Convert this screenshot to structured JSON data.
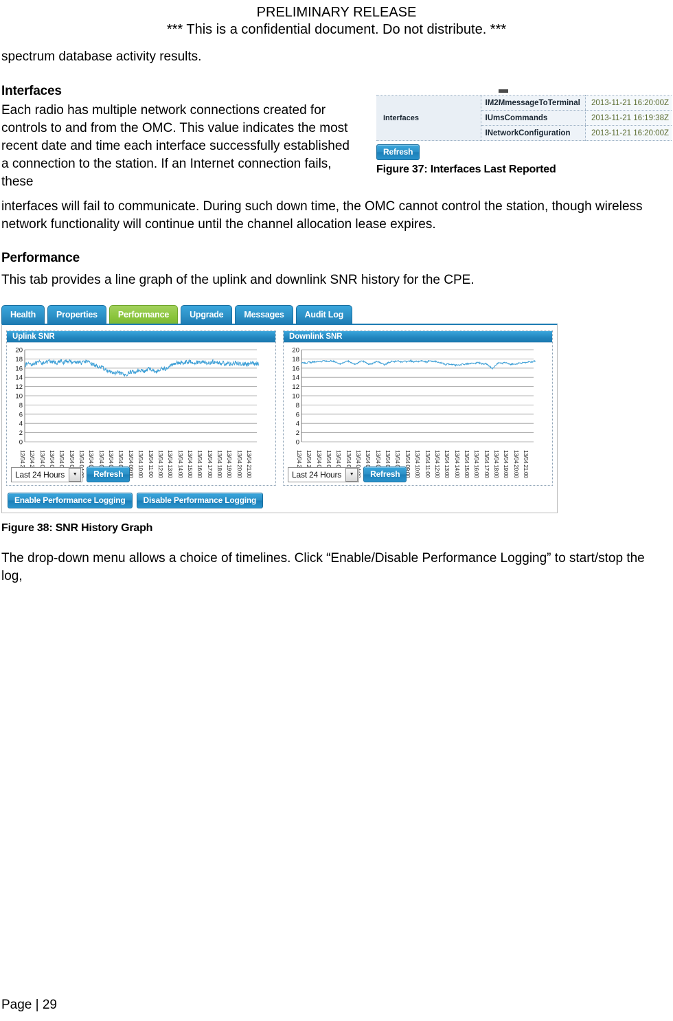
{
  "doc_header": {
    "line1": "PRELIMINARY RELEASE",
    "line2": "*** This is a confidential document. Do not distribute. ***"
  },
  "intro_text": "spectrum database activity results.",
  "sections": {
    "interfaces": {
      "heading": "Interfaces",
      "paragraph_a": "Each radio has multiple network connections created for controls to and from the OMC. This value indicates the most recent date and time each interface successfully established a connection to the station. If an Internet connection fails, these",
      "paragraph_b": "interfaces will fail to communicate. During such down time, the OMC cannot control the station, though wireless network functionality will continue until the channel allocation lease expires."
    },
    "performance": {
      "heading": "Performance",
      "paragraph": "This tab provides a line graph of the uplink and downlink SNR history for the CPE.",
      "closing": "The drop-down menu allows a choice of timelines. Click “Enable/Disable Performance Logging” to start/stop the log,"
    }
  },
  "figure37": {
    "caption": "Figure 37: Interfaces Last Reported",
    "row_label": "Interfaces",
    "rows": [
      {
        "name": "IM2MmessageToTerminal",
        "date": "2013-11-21 16:20:00Z"
      },
      {
        "name": "IUmsCommands",
        "date": "2013-11-21 16:19:38Z"
      },
      {
        "name": "INetworkConfiguration",
        "date": "2013-11-21 16:20:00Z"
      }
    ],
    "refresh_label": "Refresh"
  },
  "figure38": {
    "caption": "Figure 38: SNR History Graph",
    "tabs": [
      {
        "label": "Health",
        "active": false
      },
      {
        "label": "Properties",
        "active": false
      },
      {
        "label": "Performance",
        "active": true
      },
      {
        "label": "Upgrade",
        "active": false
      },
      {
        "label": "Messages",
        "active": false
      },
      {
        "label": "Audit Log",
        "active": false
      }
    ],
    "timeline_selected": "Last 24 Hours",
    "refresh_label": "Refresh",
    "enable_logging_label": "Enable Performance Logging",
    "disable_logging_label": "Disable Performance Logging",
    "colors": {
      "line": "#3d9fd6",
      "tab_active": "#8cc63e",
      "tab_blue": "#2e93c9",
      "panel_header": "#2184bd"
    }
  },
  "chart_data": [
    {
      "type": "line",
      "title": "Uplink SNR",
      "xlabel": "",
      "ylabel": "",
      "ylim": [
        0,
        20
      ],
      "yticks": [
        0,
        2,
        4,
        6,
        8,
        10,
        12,
        14,
        16,
        18,
        20
      ],
      "grid": true,
      "legend": "none",
      "tick_labels": [
        "12/04 22:00",
        "12/04 23:00",
        "13/04 00:00",
        "13/04 01:00",
        "13/04 02:00",
        "13/04 03:00",
        "13/04 04:00",
        "13/04 05:00",
        "13/04 06:00",
        "13/04 07:00",
        "13/04 08:00",
        "13/04 09:00",
        "13/04 10:00",
        "13/04 11:00",
        "13/04 12:00",
        "13/04 13:00",
        "13/04 14:00",
        "13/04 15:00",
        "13/04 16:00",
        "13/04 17:00",
        "13/04 18:00",
        "13/04 19:00",
        "13/04 20:00",
        "13/04 21:00"
      ],
      "series": [
        {
          "name": "Uplink SNR",
          "values": [
            16.6,
            16.9,
            17.1,
            16.8,
            17.2,
            17.0,
            17.3,
            17.1,
            17.4,
            17.2,
            17.5,
            17.2,
            17.4,
            17.1,
            17.3,
            17.5,
            17.2,
            17.4,
            17.6,
            17.3,
            17.5,
            17.2,
            17.4,
            17.1,
            17.3,
            17.5,
            17.2,
            17.0,
            16.8,
            16.6,
            16.4,
            16.2,
            16.0,
            15.7,
            15.4,
            15.2,
            15.0,
            14.8,
            15.0,
            14.9,
            14.6,
            14.4,
            14.8,
            15.1,
            15.3,
            15.0,
            15.4,
            15.7,
            15.5,
            15.2,
            15.6,
            15.9,
            15.7,
            15.4,
            15.2,
            15.5,
            15.8,
            16.0,
            15.8,
            16.2,
            16.6,
            17.0,
            17.2,
            17.0,
            17.3,
            17.1,
            17.4,
            17.2,
            17.5,
            17.3,
            17.1,
            17.4,
            17.2,
            17.5,
            17.3,
            17.0,
            17.2,
            17.4,
            17.1,
            17.3,
            17.0,
            17.2,
            16.9,
            17.1,
            16.8,
            17.0,
            17.2,
            16.9,
            17.1,
            16.8,
            17.0,
            16.7,
            16.9,
            17.1,
            16.8,
            17.0
          ]
        }
      ]
    },
    {
      "type": "line",
      "title": "Downlink SNR",
      "xlabel": "",
      "ylabel": "",
      "ylim": [
        0,
        20
      ],
      "yticks": [
        0,
        2,
        4,
        6,
        8,
        10,
        12,
        14,
        16,
        18,
        20
      ],
      "grid": true,
      "legend": "none",
      "tick_labels": [
        "12/04 22:00",
        "12/04 23:00",
        "13/04 00:00",
        "13/04 01:00",
        "13/04 02:00",
        "13/04 03:00",
        "13/04 04:00",
        "13/04 05:00",
        "13/04 06:00",
        "13/04 07:00",
        "13/04 08:00",
        "13/04 09:00",
        "13/04 10:00",
        "13/04 11:00",
        "13/04 12:00",
        "13/04 13:00",
        "13/04 14:00",
        "13/04 15:00",
        "13/04 16:00",
        "13/04 17:00",
        "13/04 18:00",
        "13/04 19:00",
        "13/04 20:00",
        "13/04 21:00"
      ],
      "series": [
        {
          "name": "Downlink SNR",
          "values": [
            17.0,
            17.2,
            17.1,
            17.3,
            17.2,
            17.4,
            17.3,
            17.5,
            17.4,
            17.6,
            17.5,
            17.4,
            17.6,
            17.5,
            17.3,
            17.1,
            16.9,
            17.2,
            17.4,
            17.6,
            17.3,
            17.0,
            16.8,
            17.1,
            17.4,
            17.6,
            17.3,
            17.0,
            16.8,
            17.0,
            17.3,
            17.5,
            17.2,
            17.0,
            16.7,
            17.0,
            17.3,
            17.5,
            17.4,
            17.6,
            17.5,
            17.3,
            17.6,
            17.4,
            17.6,
            17.5,
            17.3,
            17.5,
            17.4,
            17.6,
            17.5,
            17.3,
            17.5,
            17.6,
            17.4,
            17.5,
            17.3,
            17.2,
            17.0,
            16.8,
            16.9,
            16.7,
            16.8,
            16.6,
            16.8,
            16.7,
            16.9,
            16.8,
            17.0,
            16.9,
            17.1,
            17.0,
            17.2,
            17.1,
            16.9,
            17.0,
            16.8,
            16.4,
            15.9,
            16.3,
            16.9,
            17.2,
            17.0,
            17.2,
            17.1,
            16.9,
            16.8,
            17.0,
            16.9,
            17.1,
            17.0,
            17.3,
            17.2,
            17.4,
            17.3,
            17.5
          ]
        }
      ]
    }
  ],
  "page_footer": "Page | 29"
}
